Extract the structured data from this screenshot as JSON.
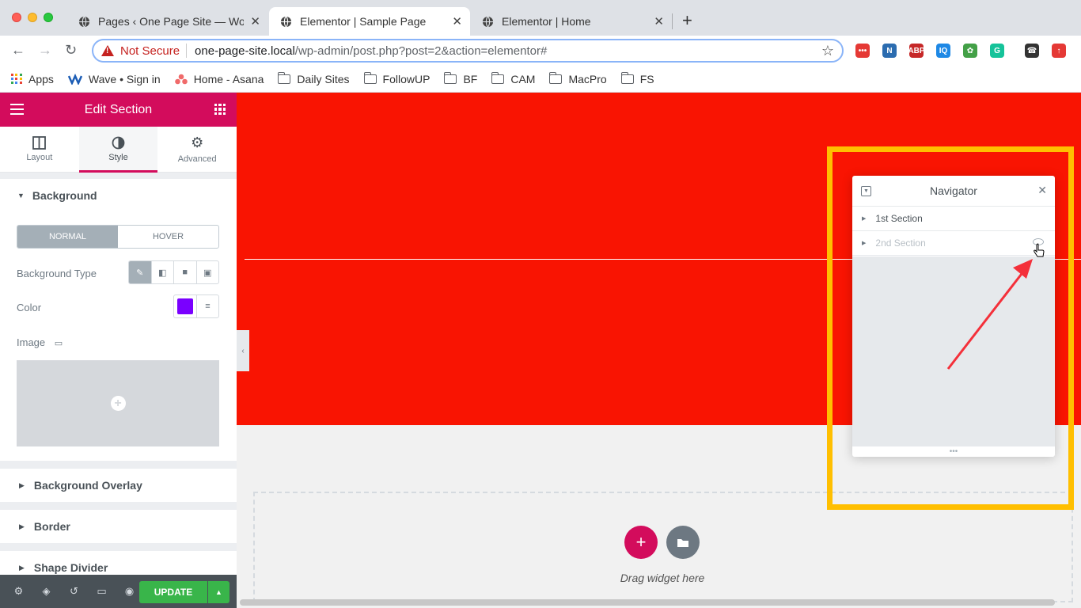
{
  "browser": {
    "tabs": [
      {
        "title": "Pages ‹ One Page Site — Word",
        "active": false
      },
      {
        "title": "Elementor | Sample Page",
        "active": true
      },
      {
        "title": "Elementor | Home",
        "active": false
      }
    ],
    "address": {
      "security_label": "Not Secure",
      "host": "one-page-site.local",
      "path": "/wp-admin/post.php?post=2&action=elementor#"
    },
    "extensions": [
      {
        "name": "ext-red",
        "label": "•••",
        "color": "#e53935"
      },
      {
        "name": "ext-n",
        "label": "N",
        "color": "#2b6cb0"
      },
      {
        "name": "ext-abp",
        "label": "ABP",
        "color": "#c62828"
      },
      {
        "name": "ext-iq",
        "label": "IQ",
        "color": "#1e88e5"
      },
      {
        "name": "ext-color",
        "label": "✿",
        "color": "#43a047"
      },
      {
        "name": "ext-grammarly",
        "label": "G",
        "color": "#15c39a"
      },
      {
        "name": "ext-phone",
        "label": "☎",
        "color": "#333333"
      },
      {
        "name": "ext-upload",
        "label": "↑",
        "color": "#e53935"
      }
    ],
    "bookmarks": [
      {
        "label": "Apps",
        "icon": "apps-grid"
      },
      {
        "label": "Wave • Sign in",
        "icon": "wave-logo"
      },
      {
        "label": "Home - Asana",
        "icon": "asana-logo"
      },
      {
        "label": "Daily Sites",
        "icon": "folder"
      },
      {
        "label": "FollowUP",
        "icon": "folder"
      },
      {
        "label": "BF",
        "icon": "folder"
      },
      {
        "label": "CAM",
        "icon": "folder"
      },
      {
        "label": "MacPro",
        "icon": "folder"
      },
      {
        "label": "FS",
        "icon": "folder"
      }
    ]
  },
  "panel": {
    "title": "Edit Section",
    "tabs": [
      {
        "label": "Layout",
        "icon": "layout-icon",
        "active": false
      },
      {
        "label": "Style",
        "icon": "style-icon",
        "active": true
      },
      {
        "label": "Advanced",
        "icon": "gear-icon",
        "active": false
      }
    ],
    "background": {
      "heading": "Background",
      "states": [
        "NORMAL",
        "HOVER"
      ],
      "active_state": "NORMAL",
      "type_label": "Background Type",
      "color_label": "Color",
      "color_value": "#7a00ff",
      "image_label": "Image"
    },
    "collapsed_sections": [
      "Background Overlay",
      "Border",
      "Shape Divider"
    ],
    "update_label": "UPDATE"
  },
  "canvas": {
    "section_color": "#f91402",
    "drag_text": "Drag widget here"
  },
  "navigator": {
    "title": "Navigator",
    "items": [
      {
        "label": "1st Section",
        "hidden": false
      },
      {
        "label": "2nd Section",
        "hidden": true
      }
    ]
  },
  "colors": {
    "elementor_accent": "#d30c5c",
    "update_green": "#39b54a",
    "highlight": "#ffbf00",
    "arrow": "#f4303a"
  }
}
